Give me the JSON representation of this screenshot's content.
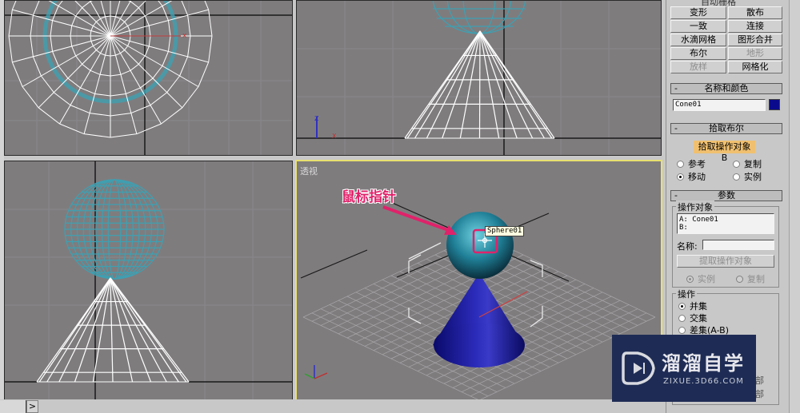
{
  "viewports": {
    "top": {
      "label": ""
    },
    "front": {
      "label": ""
    },
    "left": {
      "label": ""
    },
    "perspective": {
      "label": "透视",
      "active": true,
      "border_color": "#e8e070"
    }
  },
  "annotation": {
    "text": "鼠标指针",
    "color": "#e0226a"
  },
  "tooltip": {
    "text": "Sphere01"
  },
  "timeline": {
    "next_label": ">"
  },
  "command_panel": {
    "top_partial_label": "自动栅格",
    "object_type_buttons": [
      {
        "label": "变形",
        "enabled": true
      },
      {
        "label": "散布",
        "enabled": true
      },
      {
        "label": "一致",
        "enabled": true
      },
      {
        "label": "连接",
        "enabled": true
      },
      {
        "label": "水滴网格",
        "enabled": true
      },
      {
        "label": "图形合并",
        "enabled": true
      },
      {
        "label": "布尔",
        "enabled": true
      },
      {
        "label": "地形",
        "enabled": false
      },
      {
        "label": "放样",
        "enabled": false
      },
      {
        "label": "网格化",
        "enabled": true
      }
    ],
    "name_color": {
      "header": "名称和颜色",
      "name_value": "Cone01",
      "color": "#0a0a8c"
    },
    "pick_boolean": {
      "header": "拾取布尔",
      "pick_button": "拾取操作对象 B",
      "options": [
        {
          "label": "参考",
          "selected": false
        },
        {
          "label": "复制",
          "selected": false
        },
        {
          "label": "移动",
          "selected": true
        },
        {
          "label": "实例",
          "selected": false
        }
      ]
    },
    "parameters": {
      "header": "参数",
      "operands_title": "操作对象",
      "operand_a": "A: Cone01",
      "operand_b": "B:",
      "name_label": "名称:",
      "name_value": "",
      "extract_button": "提取操作对象",
      "extract_options": [
        {
          "label": "实例",
          "selected": true
        },
        {
          "label": "复制",
          "selected": false
        }
      ],
      "operation_title": "操作",
      "operations": [
        {
          "label": "并集",
          "selected": true
        },
        {
          "label": "交集",
          "selected": false
        },
        {
          "label": "差集(A-B)",
          "selected": false
        }
      ],
      "partial_labels": [
        "部",
        "部"
      ]
    }
  },
  "watermark": {
    "title": "溜溜自学",
    "url": "ZIXUE.3D66.COM",
    "bg_color": "#1e2c55"
  }
}
